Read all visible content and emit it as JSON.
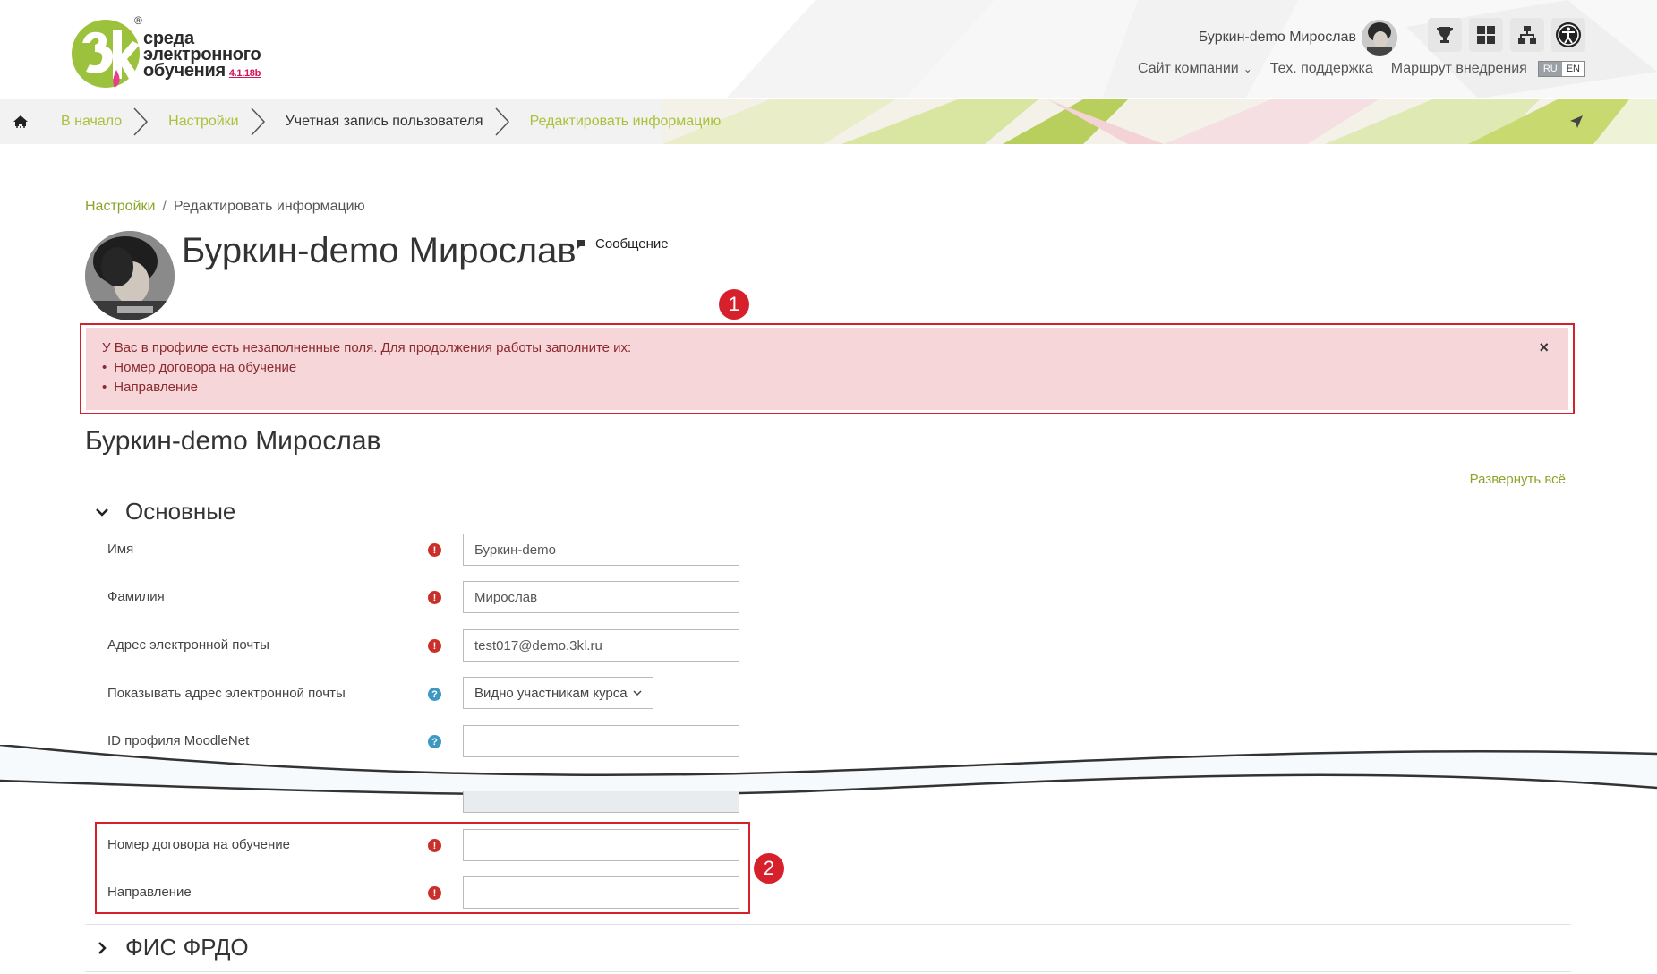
{
  "header": {
    "logo": {
      "line1": "среда",
      "line2": "электронного",
      "line3": "обучения",
      "version": "4.1.18b",
      "reg_mark": "®"
    },
    "user_name": "Буркин-demo Мирослав",
    "nav": {
      "company_site": "Сайт компании",
      "support": "Тех. поддержка",
      "route": "Маршрут внедрения"
    },
    "lang": {
      "ru": "RU",
      "en": "EN"
    },
    "icons": [
      "trophy-icon",
      "dashboard-icon",
      "hierarchy-icon",
      "accessibility-icon"
    ]
  },
  "breadcrumb_bar": {
    "items": [
      {
        "label": "В начало"
      },
      {
        "label": "Настройки"
      },
      {
        "label": "Учетная запись пользователя"
      },
      {
        "label": "Редактировать информацию"
      }
    ]
  },
  "page": {
    "crumb": {
      "link": "Настройки",
      "sep": "/",
      "current": "Редактировать информацию"
    },
    "profile_name": "Буркин-demo Мирослав",
    "message_label": "Сообщение",
    "badge1": "1",
    "badge2": "2",
    "alert": {
      "text": "У Вас в профиле есть незаполненные поля. Для продолжения работы заполните их:",
      "items": [
        "Номер договора на обучение",
        "Направление"
      ],
      "close": "×"
    },
    "section_title": "Буркин-demo Мирослав",
    "expand_all": "Развернуть всё",
    "group_main": "Основные",
    "group_fis": "ФИС ФРДО",
    "fields": {
      "first_name": {
        "label": "Имя",
        "value": "Буркин-demo"
      },
      "last_name": {
        "label": "Фамилия",
        "value": "Мирослав"
      },
      "email": {
        "label": "Адрес электронной почты",
        "value": "test017@demo.3kl.ru"
      },
      "email_visibility": {
        "label": "Показывать адрес электронной почты",
        "value": "Видно участникам курса"
      },
      "moodlenet": {
        "label": "ID профиля MoodleNet",
        "value": ""
      },
      "contract": {
        "label": "Номер договора на обучение",
        "value": ""
      },
      "direction": {
        "label": "Направление",
        "value": ""
      }
    }
  },
  "colors": {
    "accent_green": "#8aa52a",
    "alert_bg": "#f6d6d9",
    "alert_text": "#8a2a2f",
    "highlight_red": "#d6202b",
    "required_red": "#c9302c",
    "help_blue": "#3d98c4"
  }
}
